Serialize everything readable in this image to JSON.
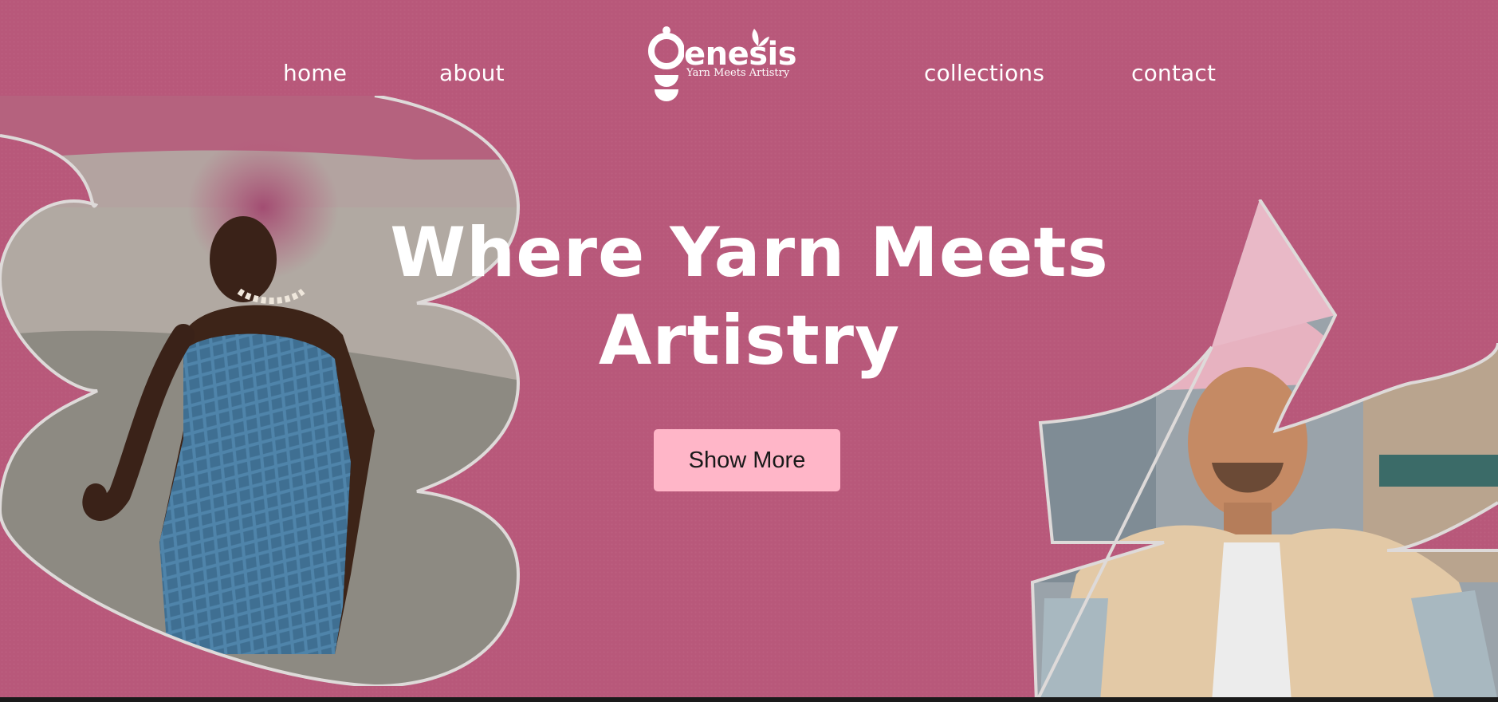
{
  "nav": {
    "links": [
      "home",
      "about",
      "collections",
      "contact"
    ]
  },
  "logo": {
    "wordmark": "enesis",
    "tagline": "Yarn Meets Artistry"
  },
  "hero": {
    "title_line1": "Where Yarn Meets",
    "title_line2": "Artistry",
    "cta_label": "Show More"
  },
  "colors": {
    "background": "#b8587a",
    "button": "#ffb6c8",
    "text": "#ffffff",
    "outline": "#dedad9"
  }
}
